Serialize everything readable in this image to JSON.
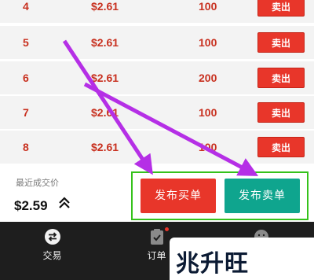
{
  "orders": [
    {
      "index": "4",
      "price": "$2.61",
      "qty": "100",
      "action": "卖出"
    },
    {
      "index": "5",
      "price": "$2.61",
      "qty": "100",
      "action": "卖出"
    },
    {
      "index": "6",
      "price": "$2.61",
      "qty": "200",
      "action": "卖出"
    },
    {
      "index": "7",
      "price": "$2.61",
      "qty": "100",
      "action": "卖出"
    },
    {
      "index": "8",
      "price": "$2.61",
      "qty": "100",
      "action": "卖出"
    }
  ],
  "panel": {
    "last_price_label": "最近成交价",
    "last_price": "$2.59",
    "trend_icon": "chevron-up-double-icon",
    "publish_buy_label": "发布买单",
    "publish_sell_label": "发布卖单"
  },
  "tabbar": {
    "tabs": [
      {
        "label": "交易",
        "icon": "swap-icon"
      },
      {
        "label": "订单",
        "icon": "clipboard-check-icon",
        "badge": true
      },
      {
        "label": "",
        "icon": "smile-icon"
      }
    ]
  },
  "watermark": {
    "text": "兆升旺"
  },
  "colors": {
    "sell_red": "#e8362a",
    "buy_green": "#0fa58e",
    "price_red": "#c8301f",
    "highlight_green": "#35c21b",
    "arrow_purple": "#b52fe6",
    "tabbar_bg": "#1e1e1e"
  }
}
